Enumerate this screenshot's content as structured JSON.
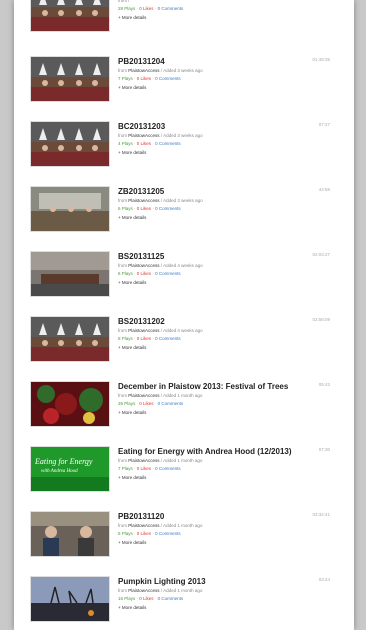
{
  "videos": [
    {
      "title": "",
      "from": "",
      "added": "",
      "plays": "28 Plays",
      "likes": "0 Likes",
      "comments": "0 Comments",
      "more": "+ More details",
      "duration": "",
      "thumb": "council"
    },
    {
      "title": "PB20131204",
      "from": "PlaistowAccess",
      "added": "Added 3 weeks ago",
      "plays": "7 Plays",
      "likes": "0 Likes",
      "comments": "0 Comments",
      "more": "+ More details",
      "duration": "01:48:35",
      "thumb": "council"
    },
    {
      "title": "BC20131203",
      "from": "PlaistowAccess",
      "added": "Added 3 weeks ago",
      "plays": "4 Plays",
      "likes": "0 Likes",
      "comments": "0 Comments",
      "more": "+ More details",
      "duration": "07:27",
      "thumb": "council"
    },
    {
      "title": "ZB20131205",
      "from": "PlaistowAccess",
      "added": "Added 3 weeks ago",
      "plays": "6 Plays",
      "likes": "0 Likes",
      "comments": "0 Comments",
      "more": "+ More details",
      "duration": "44:55",
      "thumb": "room"
    },
    {
      "title": "BS20131125",
      "from": "PlaistowAccess",
      "added": "Added 4 weeks ago",
      "plays": "6 Plays",
      "likes": "0 Likes",
      "comments": "0 Comments",
      "more": "+ More details",
      "duration": "02:04:27",
      "thumb": "room2"
    },
    {
      "title": "BS20131202",
      "from": "PlaistowAccess",
      "added": "Added 4 weeks ago",
      "plays": "8 Plays",
      "likes": "0 Likes",
      "comments": "0 Comments",
      "more": "+ More details",
      "duration": "02:58:09",
      "thumb": "council"
    },
    {
      "title": "December in Plaistow 2013: Festival of Trees",
      "from": "PlaistowAccess",
      "added": "Added 1 month ago",
      "plays": "35 Plays",
      "likes": "0 Likes",
      "comments": "0 Comments",
      "more": "+ More details",
      "duration": "05:43",
      "thumb": "tree"
    },
    {
      "title": "Eating for Energy with Andrea Hood (12/2013)",
      "from": "PlaistowAccess",
      "added": "Added 1 month ago",
      "plays": "7 Plays",
      "likes": "0 Likes",
      "comments": "0 Comments",
      "more": "+ More details",
      "duration": "07:30",
      "thumb": "green",
      "thumb_text": "Eating for Energy",
      "thumb_sub": "with Andrea Hood"
    },
    {
      "title": "PB20131120",
      "from": "PlaistowAccess",
      "added": "Added 1 month ago",
      "plays": "5 Plays",
      "likes": "0 Likes",
      "comments": "0 Comments",
      "more": "+ More details",
      "duration": "03:32:41",
      "thumb": "people"
    },
    {
      "title": "Pumpkin Lighting 2013",
      "from": "PlaistowAccess",
      "added": "Added 1 month ago",
      "plays": "16 Plays",
      "likes": "0 Likes",
      "comments": "0 Comments",
      "more": "+ More details",
      "duration": "03:44",
      "thumb": "night"
    }
  ],
  "labels": {
    "from_prefix": "from",
    "sep": " / ",
    "dot": " · "
  }
}
